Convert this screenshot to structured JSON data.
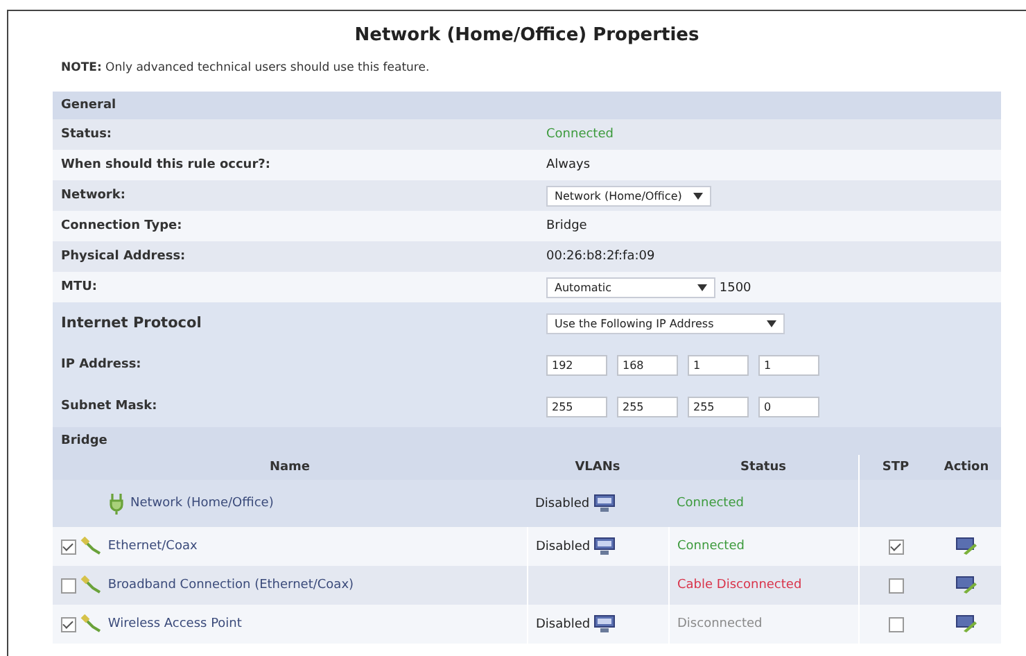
{
  "title": "Network (Home/Office) Properties",
  "note": {
    "label": "NOTE:",
    "text": "Only advanced technical users should use this feature."
  },
  "general": {
    "heading": "General",
    "rows": [
      {
        "kind": "text",
        "label": "Status:",
        "value": "Connected",
        "color": "#3c9a3c"
      },
      {
        "kind": "text",
        "label": "When should this rule occur?:",
        "value": "Always"
      },
      {
        "kind": "select",
        "label": "Network:",
        "value": "Network (Home/Office)"
      },
      {
        "kind": "text",
        "label": "Connection Type:",
        "value": "Bridge"
      },
      {
        "kind": "text",
        "label": "Physical Address:",
        "value": "00:26:b8:2f:fa:09"
      },
      {
        "kind": "select",
        "label": "MTU:",
        "value": "Automatic",
        "extra": "1500"
      },
      {
        "kind": "protocol",
        "label": "Internet Protocol",
        "value": "Use the Following IP Address"
      },
      {
        "kind": "ip",
        "label": "IP Address:",
        "octets": [
          "192",
          "168",
          "1",
          "1"
        ]
      },
      {
        "kind": "ip",
        "label": "Subnet Mask:",
        "octets": [
          "255",
          "255",
          "255",
          "0"
        ]
      }
    ]
  },
  "bridge": {
    "heading": "Bridge",
    "columns": [
      "Name",
      "VLANs",
      "Status",
      "STP",
      "Action"
    ],
    "rows": [
      {
        "kind": "network",
        "name": "Network (Home/Office)",
        "vlans": "Disabled",
        "status": "Connected",
        "color": "#3c9a3c"
      },
      {
        "kind": "port",
        "checked": true,
        "name": "Ethernet/Coax",
        "vlans": "Disabled",
        "status": "Connected",
        "color": "#3c9a3c",
        "stp": true
      },
      {
        "kind": "port",
        "checked": false,
        "name": "Broadband Connection (Ethernet/Coax)",
        "status": "Cable Disconnected",
        "color": "#d9334a",
        "stp": false
      },
      {
        "kind": "port",
        "checked": true,
        "name": "Wireless Access Point",
        "vlans": "Disabled",
        "status": "Disconnected",
        "color": "#8a8a8a",
        "stp": false
      }
    ]
  }
}
